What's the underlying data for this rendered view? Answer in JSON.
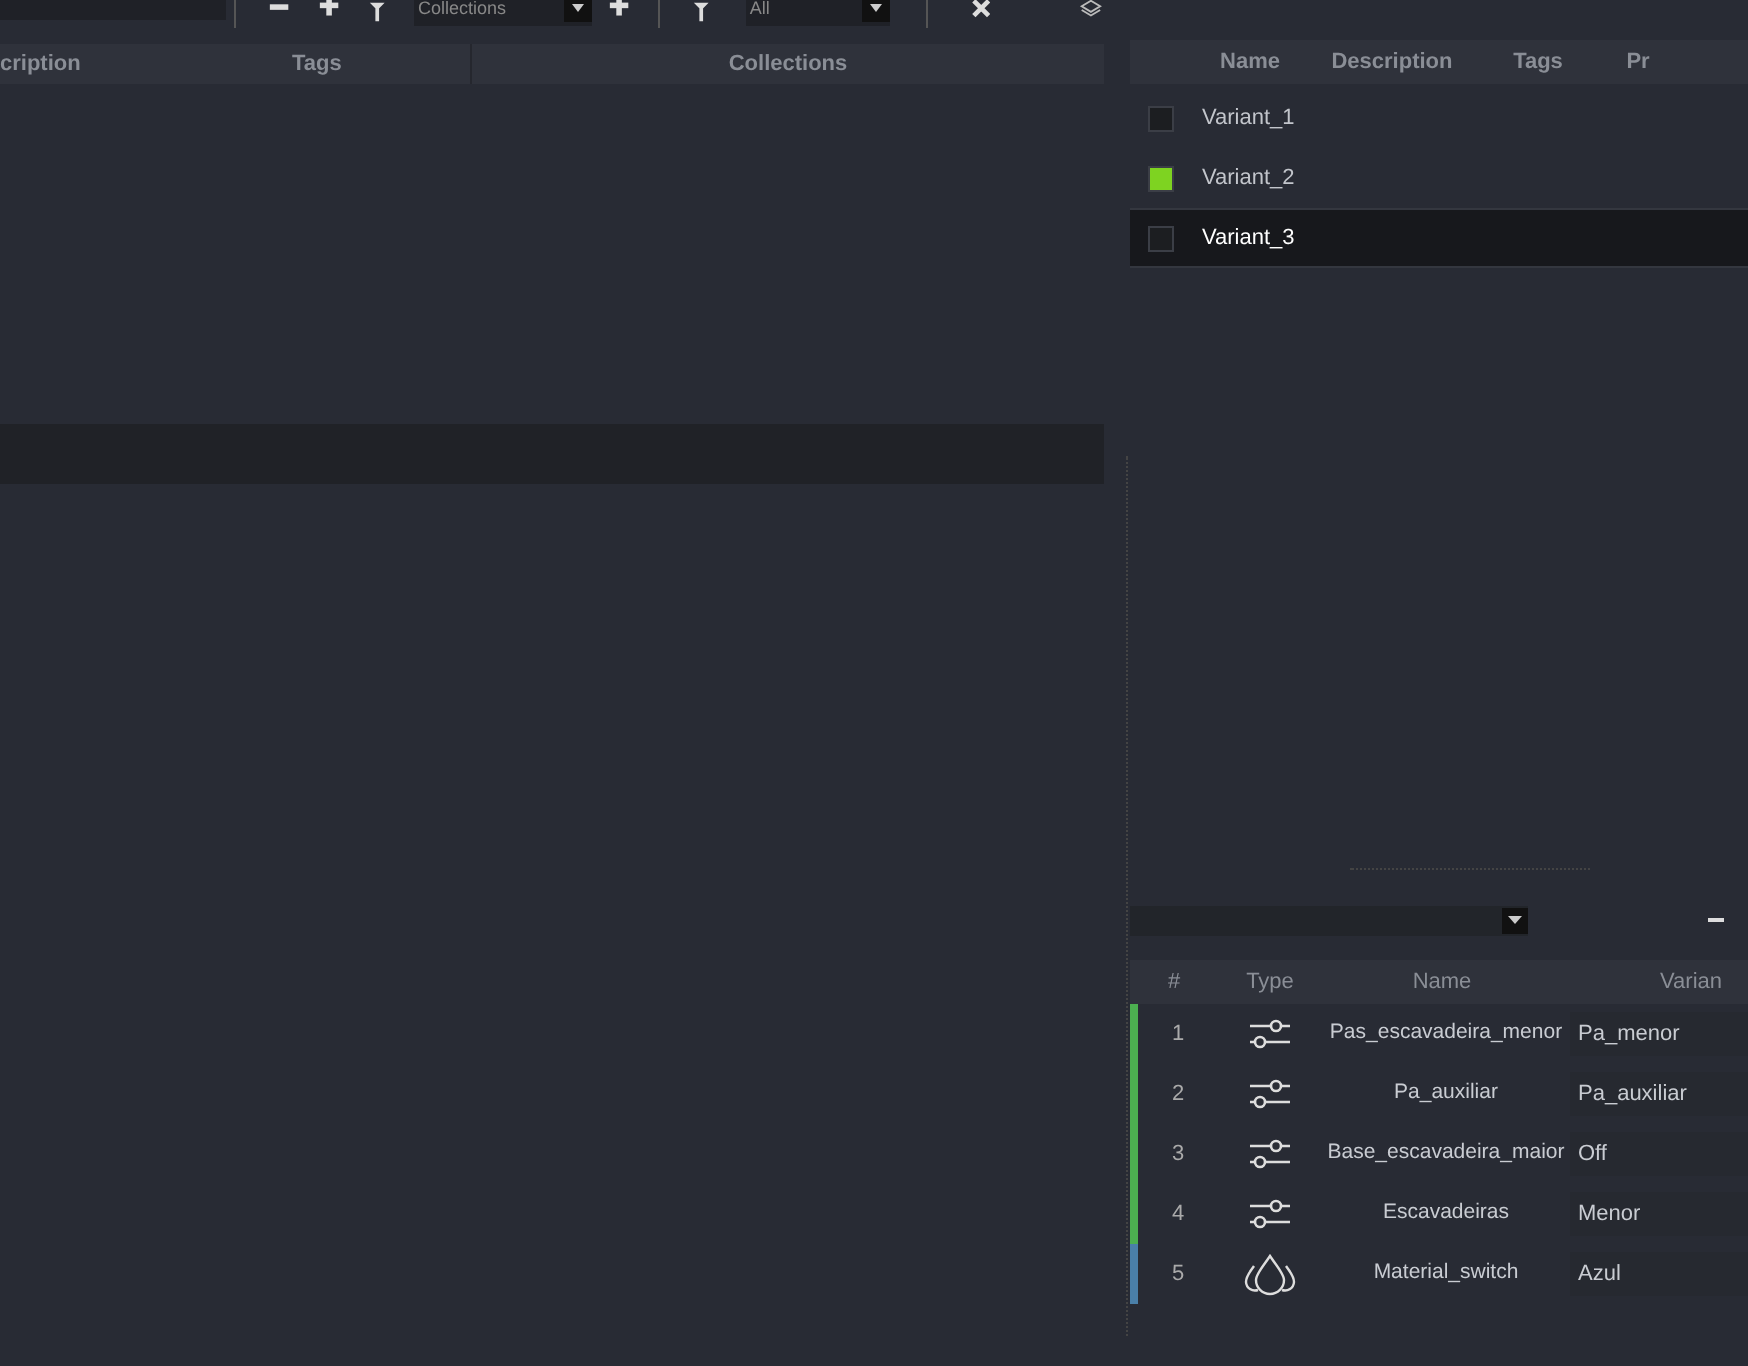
{
  "toolbar": {
    "collections_filter": "Collections",
    "tag_filter": "All"
  },
  "assets_table": {
    "columns": [
      "cription",
      "Tags",
      "Collections"
    ]
  },
  "variants_table": {
    "columns": [
      "Name",
      "Description",
      "Tags",
      "Pr"
    ],
    "rows": [
      {
        "name": "Variant_1",
        "color": "#1c1e21",
        "selected": false
      },
      {
        "name": "Variant_2",
        "color": "#7ed321",
        "selected": false
      },
      {
        "name": "Variant_3",
        "color": "#1c1e21",
        "selected": true
      }
    ]
  },
  "switches_table": {
    "columns": [
      "#",
      "Type",
      "Name",
      "Varian"
    ],
    "rows": [
      {
        "index": "1",
        "kind": "slider",
        "name": "Pas_escavadeira_menor",
        "variant": "Pa_menor",
        "color": "#4caf50"
      },
      {
        "index": "2",
        "kind": "slider",
        "name": "Pa_auxiliar",
        "variant": "Pa_auxiliar",
        "color": "#4caf50"
      },
      {
        "index": "3",
        "kind": "slider",
        "name": "Base_escavadeira_maior",
        "variant": "Off",
        "color": "#4caf50"
      },
      {
        "index": "4",
        "kind": "slider",
        "name": "Escavadeiras",
        "variant": "Menor",
        "color": "#4caf50"
      },
      {
        "index": "5",
        "kind": "material",
        "name": "Material_switch",
        "variant": "Azul",
        "color": "#4a7fa8"
      }
    ]
  }
}
